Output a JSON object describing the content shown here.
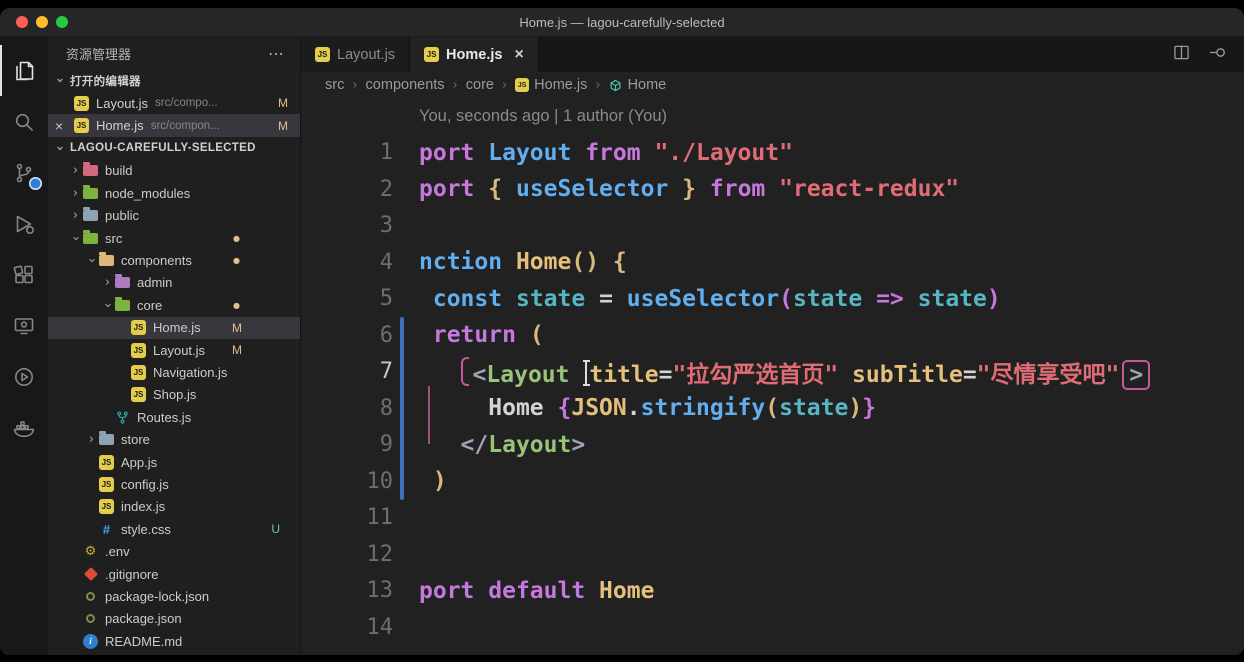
{
  "window": {
    "title": "Home.js — lagou-carefully-selected"
  },
  "activity_bar": {
    "items": [
      {
        "id": "explorer",
        "active": true,
        "badge": false
      },
      {
        "id": "search",
        "active": false,
        "badge": false
      },
      {
        "id": "source-control",
        "active": false,
        "badge": true
      },
      {
        "id": "run-debug",
        "active": false,
        "badge": false
      },
      {
        "id": "extensions",
        "active": false,
        "badge": false
      },
      {
        "id": "remote-explorer",
        "active": false,
        "badge": false
      },
      {
        "id": "live-share",
        "active": false,
        "badge": false
      },
      {
        "id": "docker",
        "active": false,
        "badge": false
      }
    ]
  },
  "sidebar": {
    "title": "资源管理器",
    "more_icon": "⋯",
    "open_editors_label": "打开的编辑器",
    "workspace_label": "LAGOU-CAREFULLY-SELECTED",
    "open_editors": [
      {
        "name": "Layout.js",
        "desc": "src/compo...",
        "badge": "M",
        "icon": "js",
        "active": false,
        "close": false
      },
      {
        "name": "Home.js",
        "desc": "src/compon...",
        "badge": "M",
        "icon": "js",
        "active": true,
        "close": true
      }
    ],
    "tree": [
      {
        "label": "build",
        "kind": "folder",
        "level": 0,
        "color": "#d3697c",
        "expanded": false
      },
      {
        "label": "node_modules",
        "kind": "folder",
        "level": 0,
        "color": "#7cb342",
        "expanded": false
      },
      {
        "label": "public",
        "kind": "folder",
        "level": 0,
        "color": "#8fa1b3",
        "expanded": false
      },
      {
        "label": "src",
        "kind": "folder",
        "level": 0,
        "color": "#7cb342",
        "expanded": true,
        "dot": true
      },
      {
        "label": "components",
        "kind": "folder",
        "level": 1,
        "color": "#dcb67a",
        "expanded": true,
        "dot": true
      },
      {
        "label": "admin",
        "kind": "folder",
        "level": 2,
        "color": "#ab7bc0",
        "expanded": false
      },
      {
        "label": "core",
        "kind": "folder",
        "level": 2,
        "color": "#7cb342",
        "expanded": true,
        "dot": true
      },
      {
        "label": "Home.js",
        "kind": "file",
        "icon": "js",
        "level": 3,
        "badge": "M",
        "selected": true
      },
      {
        "label": "Layout.js",
        "kind": "file",
        "icon": "js",
        "level": 3,
        "badge": "M"
      },
      {
        "label": "Navigation.js",
        "kind": "file",
        "icon": "js",
        "level": 3
      },
      {
        "label": "Shop.js",
        "kind": "file",
        "icon": "js",
        "level": 3
      },
      {
        "label": "Routes.js",
        "kind": "file",
        "icon": "routes",
        "level": 2
      },
      {
        "label": "store",
        "kind": "folder",
        "level": 1,
        "color": "#8fa1b3",
        "expanded": false
      },
      {
        "label": "App.js",
        "kind": "file",
        "icon": "js",
        "level": 1
      },
      {
        "label": "config.js",
        "kind": "file",
        "icon": "js",
        "level": 1
      },
      {
        "label": "index.js",
        "kind": "file",
        "icon": "js",
        "level": 1
      },
      {
        "label": "style.css",
        "kind": "file",
        "icon": "css",
        "level": 1,
        "badge": "U"
      },
      {
        "label": ".env",
        "kind": "file",
        "icon": "env",
        "level": 0
      },
      {
        "label": ".gitignore",
        "kind": "file",
        "icon": "git",
        "level": 0
      },
      {
        "label": "package-lock.json",
        "kind": "file",
        "icon": "json",
        "level": 0
      },
      {
        "label": "package.json",
        "kind": "file",
        "icon": "json",
        "level": 0
      },
      {
        "label": "README.md",
        "kind": "file",
        "icon": "info",
        "level": 0
      }
    ]
  },
  "editor": {
    "tabs": [
      {
        "label": "Layout.js",
        "icon": "js",
        "active": false,
        "close": false
      },
      {
        "label": "Home.js",
        "icon": "js",
        "active": true,
        "close": true
      }
    ],
    "breadcrumbs": [
      {
        "label": "src"
      },
      {
        "label": "components"
      },
      {
        "label": "core"
      },
      {
        "label": "Home.js",
        "icon": "js"
      },
      {
        "label": "Home",
        "icon": "symbol"
      }
    ],
    "lens": "You, seconds ago | 1 author (You)",
    "code": {
      "active_line": 7,
      "git_change_range": [
        6,
        10
      ],
      "lines": [
        [
          [
            "port",
            "kw"
          ],
          [
            " ",
            "w"
          ],
          [
            "Layout",
            "blue"
          ],
          [
            " ",
            "w"
          ],
          [
            "from",
            "kw"
          ],
          [
            " ",
            "w"
          ],
          [
            "\"./Layout\"",
            "str"
          ]
        ],
        [
          [
            "port",
            "kw"
          ],
          [
            " ",
            "w"
          ],
          [
            "{",
            "gold"
          ],
          [
            " ",
            "w"
          ],
          [
            "useSelector",
            "blue"
          ],
          [
            " ",
            "w"
          ],
          [
            "}",
            "gold"
          ],
          [
            " ",
            "w"
          ],
          [
            "from",
            "kw"
          ],
          [
            " ",
            "w"
          ],
          [
            "\"react-redux\"",
            "str"
          ]
        ],
        [],
        [
          [
            "nction",
            "blue"
          ],
          [
            " ",
            "w"
          ],
          [
            "Home",
            "fn"
          ],
          [
            "()",
            "gold"
          ],
          [
            " ",
            "w"
          ],
          [
            "{",
            "gold"
          ]
        ],
        [
          [
            " ",
            "w"
          ],
          [
            "const",
            "blue"
          ],
          [
            " ",
            "w"
          ],
          [
            "state",
            "cyan"
          ],
          [
            " = ",
            "w"
          ],
          [
            "useSelector",
            "blue"
          ],
          [
            "(",
            "pur"
          ],
          [
            "state",
            "cyan"
          ],
          [
            " ",
            "w"
          ],
          [
            "=>",
            "kw"
          ],
          [
            " ",
            "w"
          ],
          [
            "state",
            "cyan"
          ],
          [
            ")",
            "pur"
          ]
        ],
        [
          [
            " ",
            "w"
          ],
          [
            "return",
            "kw"
          ],
          [
            " ",
            "w"
          ],
          [
            "(",
            "gold"
          ]
        ],
        [
          [
            "   ",
            "w"
          ],
          [
            "",
            "lmark"
          ],
          [
            "<",
            "gray"
          ],
          [
            "Layout",
            "grn"
          ],
          [
            " ",
            "w"
          ],
          [
            "",
            "cursor"
          ],
          [
            "title",
            "attr"
          ],
          [
            "=",
            "w"
          ],
          [
            "\"拉勾严选首页\"",
            "str"
          ],
          [
            " ",
            "w"
          ],
          [
            "subTitle",
            "attr"
          ],
          [
            "=",
            "w"
          ],
          [
            "\"尽情享受吧\"",
            "str"
          ],
          [
            ">",
            "endbox"
          ]
        ],
        [
          [
            "     ",
            "w"
          ],
          [
            "Home ",
            "w"
          ],
          [
            "{",
            "pur"
          ],
          [
            "JSON",
            "fn"
          ],
          [
            ".",
            "w"
          ],
          [
            "stringify",
            "blue"
          ],
          [
            "(",
            "gold"
          ],
          [
            "state",
            "cyan"
          ],
          [
            ")",
            "gold"
          ],
          [
            "}",
            "pur"
          ]
        ],
        [
          [
            "   ",
            "w"
          ],
          [
            "</",
            "gray"
          ],
          [
            "Layout",
            "grn"
          ],
          [
            ">",
            "gray"
          ]
        ],
        [
          [
            " ",
            "w"
          ],
          [
            ")",
            "gold"
          ]
        ],
        [],
        [],
        [
          [
            "port",
            "kw"
          ],
          [
            " ",
            "w"
          ],
          [
            "default",
            "kw"
          ],
          [
            " ",
            "w"
          ],
          [
            "Home",
            "fn"
          ]
        ],
        []
      ]
    }
  },
  "colors": {
    "accent": "#2f81d7",
    "git_modified": "#e2c08d",
    "git_untracked": "#73c991",
    "change_bar": "#3f6fb5",
    "tag_highlight": "#c45a9d"
  }
}
